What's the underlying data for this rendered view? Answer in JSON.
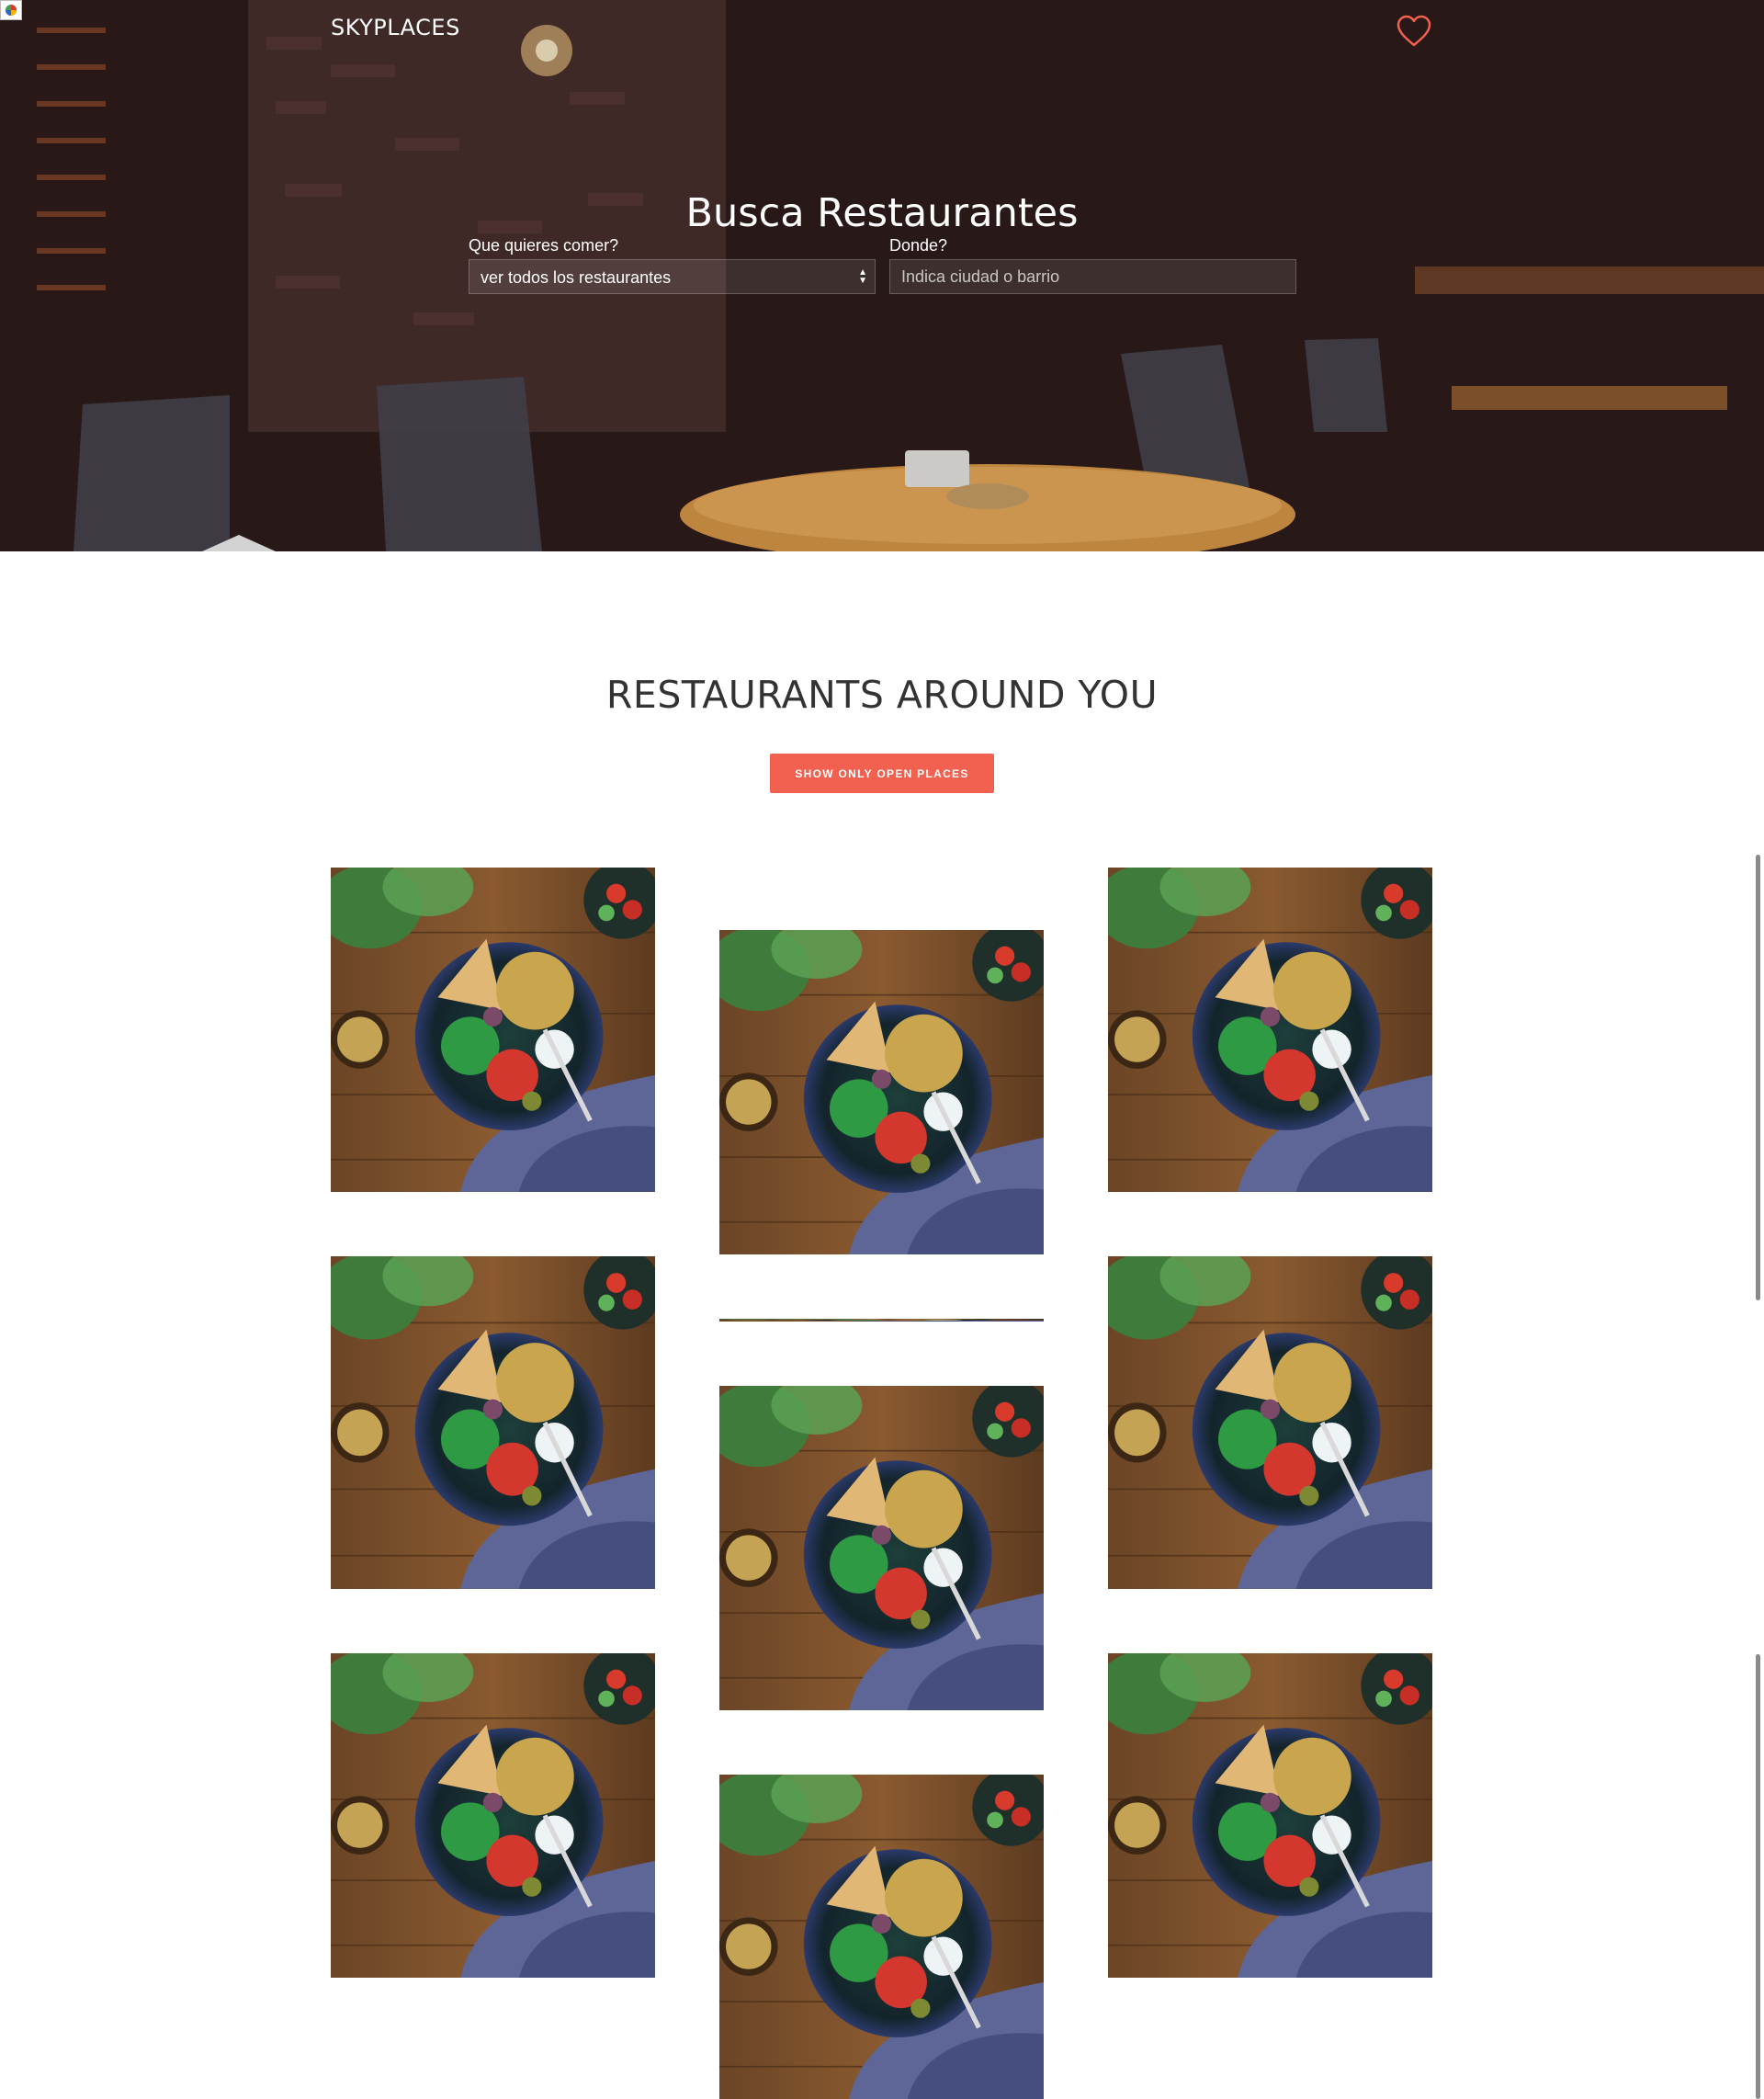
{
  "app": {
    "brand": "SKYPLACES"
  },
  "header": {
    "favorites_icon": "heart-outline-icon",
    "favorites_color": "#f2604f"
  },
  "search": {
    "title": "Busca Restaurantes",
    "what_label": "Que quieres comer?",
    "what_value": "ver todos los restaurantes",
    "where_label": "Donde?",
    "where_placeholder": "Indica ciudad o barrio"
  },
  "restaurants": {
    "title": "RESTAURANTS AROUND YOU",
    "filter_button": "SHOW ONLY OPEN PLACES",
    "accent_color": "#f2604f",
    "cards": [
      {
        "image": "food-bowl-photo"
      },
      {
        "image": "food-bowl-photo"
      },
      {
        "image": "food-bowl-photo"
      },
      {
        "image": "food-bowl-photo"
      },
      {
        "image": "food-bowl-photo"
      },
      {
        "image": "food-bowl-photo"
      },
      {
        "image": "food-bowl-photo"
      },
      {
        "image": "food-bowl-photo"
      },
      {
        "image": "food-bowl-photo"
      },
      {
        "image": "food-bowl-photo"
      }
    ]
  }
}
